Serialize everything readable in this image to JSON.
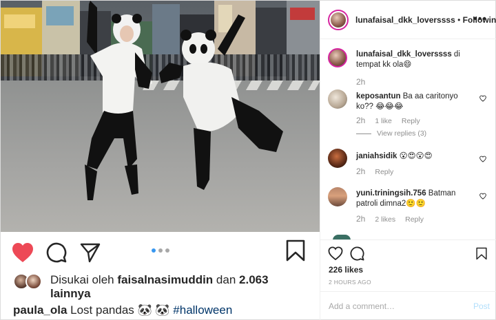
{
  "post": {
    "carousel": {
      "count": 3,
      "active": 1
    },
    "liked_by": {
      "prefix": "Disukai oleh ",
      "user": "faisalnasimuddin",
      "middle": " dan ",
      "count": "2.063",
      "suffix_line": "lainnya"
    },
    "caption": {
      "user": "paula_ola",
      "text": " Lost pandas 🐼 🐼 ",
      "hashtag": "#halloween"
    }
  },
  "panel": {
    "header": {
      "username": "lunafaisal_dkk_loverssss",
      "separator": " • ",
      "follow_state": "Following",
      "more_label": "•••"
    },
    "comments": [
      {
        "user": "lunafaisal_dkk_loverssss",
        "text": " di tempat kk ola😄",
        "time": "2h"
      },
      {
        "user": "keposantun",
        "text": " Ba aa caritonyo ko?? 😂😂😂",
        "time": "2h",
        "likes": "1 like",
        "reply": "Reply",
        "view_replies": "View replies (3)"
      },
      {
        "user": "janiahsidik",
        "text": " 😮😍😮😍",
        "time": "2h",
        "reply": "Reply"
      },
      {
        "user": "yuni.triningsih.756",
        "text": " Batman patroli dimna2🙂🙂",
        "time": "2h",
        "likes": "2 likes",
        "reply": "Reply"
      }
    ],
    "likes": "226 likes",
    "timestamp": "2 HOURS AGO",
    "add_comment_placeholder": "Add a comment…",
    "post_label": "Post"
  },
  "colors": {
    "like_red": "#ed4956",
    "link_blue": "#3897f0",
    "hashtag": "#003569"
  },
  "icons": [
    "heart-icon",
    "comment-icon",
    "share-icon",
    "bookmark-icon",
    "more-icon"
  ]
}
